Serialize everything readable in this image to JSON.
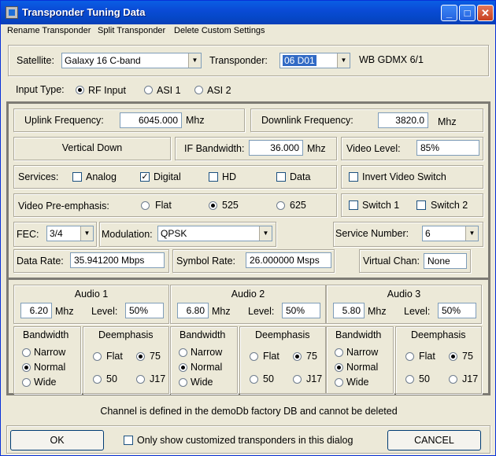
{
  "window": {
    "title": "Transponder Tuning Data",
    "controls": {
      "minimize": "_",
      "maximize": "□",
      "close": "✕"
    }
  },
  "menu": [
    "Rename Transponder",
    "Split Transponder",
    "Delete Custom Settings"
  ],
  "satellite": {
    "label": "Satellite:",
    "value": "Galaxy 16  C-band"
  },
  "transponder": {
    "label": "Transponder:",
    "value": "06 D01",
    "description": "WB GDMX 6/1"
  },
  "input_type": {
    "label": "Input Type:",
    "options": [
      "RF Input",
      "ASI 1",
      "ASI 2"
    ],
    "selected": "RF Input"
  },
  "uplink": {
    "label": "Uplink Frequency:",
    "value": "6045.000",
    "unit": "Mhz"
  },
  "downlink": {
    "label": "Downlink Frequency:",
    "value": "3820.0",
    "unit": "Mhz"
  },
  "polarization": "Vertical Down",
  "if_bandwidth": {
    "label": "IF Bandwidth:",
    "value": "36.000",
    "unit": "Mhz"
  },
  "video_level": {
    "label": "Video Level:",
    "value": "85%"
  },
  "services": {
    "label": "Services:",
    "items": [
      {
        "label": "Analog",
        "checked": false
      },
      {
        "label": "Digital",
        "checked": true
      },
      {
        "label": "HD",
        "checked": false
      },
      {
        "label": "Data",
        "checked": false
      }
    ]
  },
  "invert_video": {
    "label": "Invert Video Switch",
    "checked": false
  },
  "preemphasis": {
    "label": "Video Pre-emphasis:",
    "options": [
      "Flat",
      "525",
      "625"
    ],
    "selected": "525"
  },
  "switches": [
    {
      "label": "Switch 1",
      "checked": false
    },
    {
      "label": "Switch 2",
      "checked": false
    }
  ],
  "fec": {
    "label": "FEC:",
    "value": "3/4"
  },
  "modulation": {
    "label": "Modulation:",
    "value": "QPSK"
  },
  "service_number": {
    "label": "Service Number:",
    "value": "6"
  },
  "data_rate": {
    "label": "Data Rate:",
    "value": "35.941200 Mbps"
  },
  "symbol_rate": {
    "label": "Symbol Rate:",
    "value": "26.000000 Msps"
  },
  "virtual_chan": {
    "label": "Virtual Chan:",
    "value": "None"
  },
  "audio": [
    {
      "title": "Audio 1",
      "freq": "6.20",
      "unit": "Mhz",
      "level_label": "Level:",
      "level": "50%",
      "bandwidth_label": "Bandwidth",
      "bandwidth_options": [
        "Narrow",
        "Normal",
        "Wide"
      ],
      "bandwidth": "Normal",
      "deemph_label": "Deemphasis",
      "deemph_options": [
        "Flat",
        "75",
        "50",
        "J17"
      ],
      "deemph": "75"
    },
    {
      "title": "Audio 2",
      "freq": "6.80",
      "unit": "Mhz",
      "level_label": "Level:",
      "level": "50%",
      "bandwidth_label": "Bandwidth",
      "bandwidth_options": [
        "Narrow",
        "Normal",
        "Wide"
      ],
      "bandwidth": "Normal",
      "deemph_label": "Deemphasis",
      "deemph_options": [
        "Flat",
        "75",
        "50",
        "J17"
      ],
      "deemph": "75"
    },
    {
      "title": "Audio 3",
      "freq": "5.80",
      "unit": "Mhz",
      "level_label": "Level:",
      "level": "50%",
      "bandwidth_label": "Bandwidth",
      "bandwidth_options": [
        "Narrow",
        "Normal",
        "Wide"
      ],
      "bandwidth": "Normal",
      "deemph_label": "Deemphasis",
      "deemph_options": [
        "Flat",
        "75",
        "50",
        "J17"
      ],
      "deemph": "75"
    }
  ],
  "status": "Channel is defined in the demoDb factory DB and cannot be deleted",
  "footer": {
    "ok": "OK",
    "only_custom": {
      "label": "Only show customized transponders  in this dialog",
      "checked": false
    },
    "cancel": "CANCEL"
  }
}
